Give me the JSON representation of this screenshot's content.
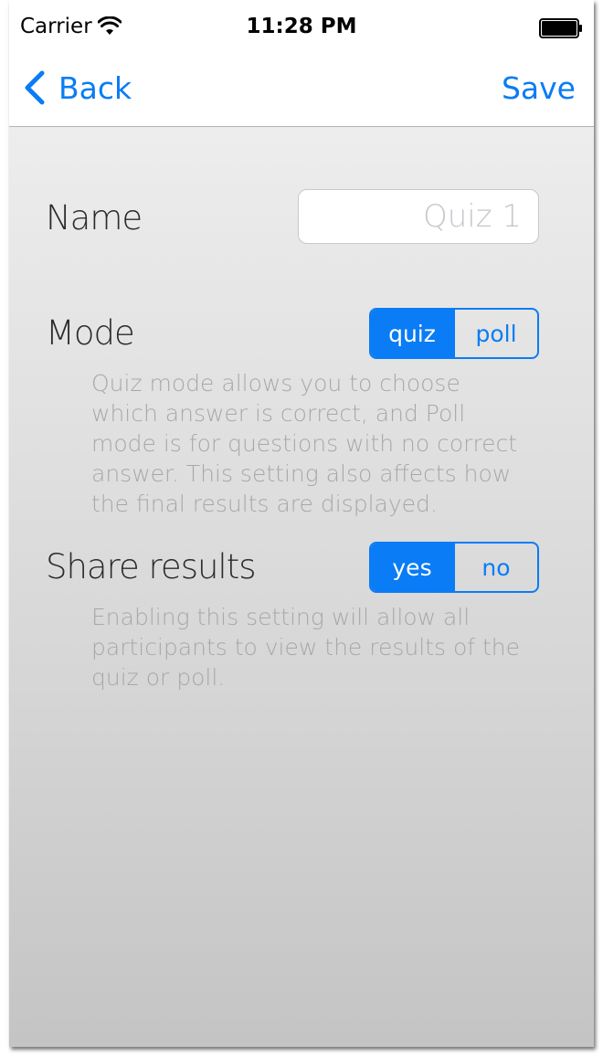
{
  "status_bar": {
    "carrier": "Carrier",
    "time": "11:28 PM"
  },
  "nav": {
    "back_label": "Back",
    "save_label": "Save"
  },
  "form": {
    "name": {
      "label": "Name",
      "value": "",
      "placeholder": "Quiz 1"
    },
    "mode": {
      "label": "Mode",
      "options": [
        "quiz",
        "poll"
      ],
      "selected": "quiz",
      "description": "Quiz mode allows you to choose which answer is correct, and Poll mode is for questions with no correct answer.  This setting also affects how the final results are displayed."
    },
    "share_results": {
      "label": "Share results",
      "options": [
        "yes",
        "no"
      ],
      "selected": "yes",
      "description": "Enabling this setting will allow all participants to view the results of the quiz or poll."
    }
  },
  "colors": {
    "accent": "#0a7cf5",
    "label_text": "#2b2b2b",
    "description_text": "#a8a8a8",
    "placeholder_text": "#c7c7cd"
  },
  "icons": {
    "wifi": "wifi-icon",
    "battery": "battery-icon",
    "back": "chevron-left-icon"
  }
}
